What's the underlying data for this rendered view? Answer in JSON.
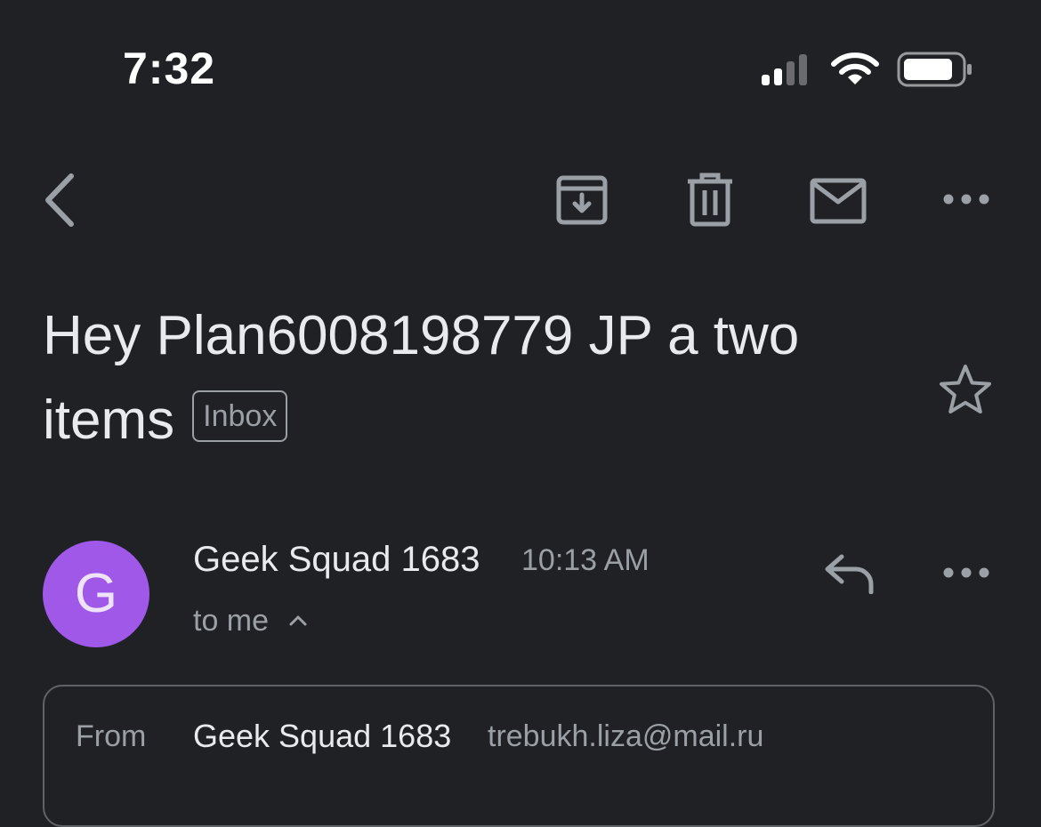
{
  "status_bar": {
    "time": "7:32",
    "icons": [
      "cellular-signal-icon",
      "wifi-icon",
      "battery-icon"
    ]
  },
  "toolbar": {
    "icons": [
      "back-chevron-icon",
      "archive-icon",
      "trash-icon",
      "mail-unread-icon",
      "more-horizontal-icon"
    ]
  },
  "email": {
    "subject_line_1": "Hey Plan6008198779 JP a two",
    "subject_line_2": "items",
    "label_chip": "Inbox",
    "star_icon": "star-outline-icon"
  },
  "message": {
    "avatar_letter": "G",
    "sender_name": "Geek Squad 1683",
    "time": "10:13 AM",
    "recipient": "to me",
    "details": {
      "from_label": "From",
      "from_name": "Geek Squad 1683",
      "from_email": "trebukh.liza@mail.ru"
    }
  },
  "colors": {
    "background": "#202124",
    "avatar": "#9f58e8",
    "text_primary": "#e8eaed",
    "text_secondary": "#9aa0a6"
  }
}
